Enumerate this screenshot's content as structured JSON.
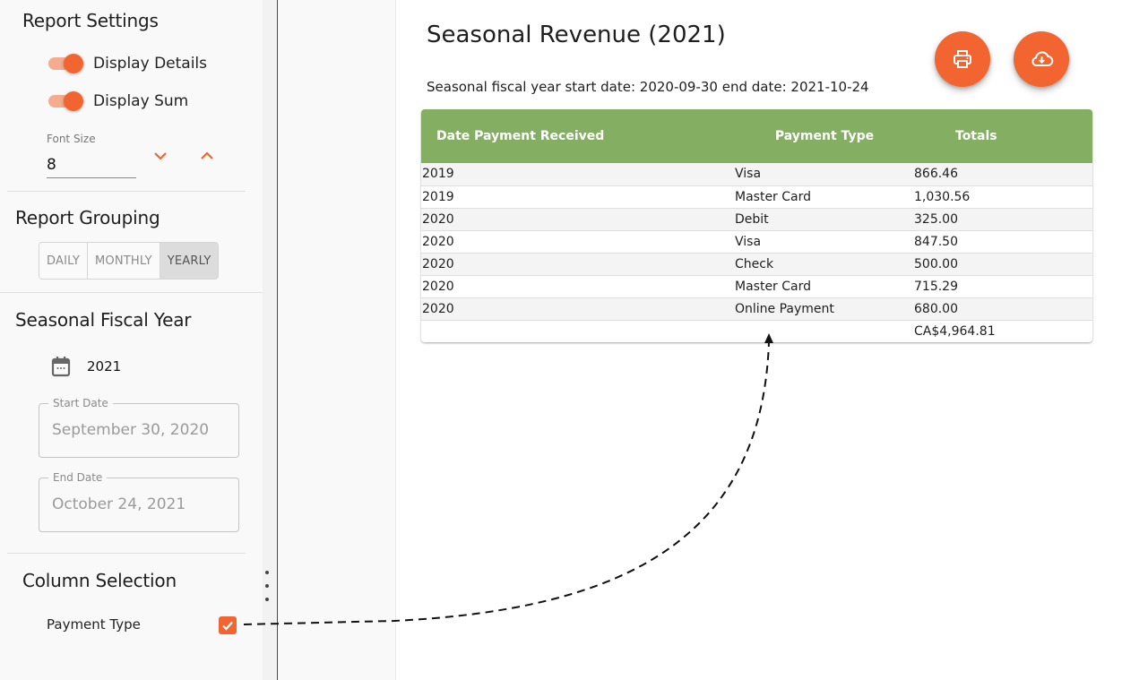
{
  "sidebar": {
    "report_settings": {
      "title": "Report Settings",
      "display_details": {
        "label": "Display Details",
        "checked": true
      },
      "display_sum": {
        "label": "Display Sum",
        "checked": true
      },
      "font_size": {
        "label": "Font Size",
        "value": "8"
      }
    },
    "report_grouping": {
      "title": "Report Grouping",
      "options": [
        "DAILY",
        "MONTHLY",
        "YEARLY"
      ],
      "selected": "YEARLY"
    },
    "seasonal_fiscal_year": {
      "title": "Seasonal Fiscal Year",
      "year": "2021",
      "start_date": {
        "label": "Start Date",
        "value": "September 30, 2020"
      },
      "end_date": {
        "label": "End Date",
        "value": "October 24, 2021"
      }
    },
    "column_selection": {
      "title": "Column Selection",
      "items": [
        {
          "label": "Payment Type",
          "checked": true
        }
      ]
    }
  },
  "report": {
    "title": "Seasonal Revenue (2021)",
    "subtitle": "Seasonal fiscal year start date: 2020-09-30 end date: 2021-10-24",
    "actions": {
      "print": "print-icon",
      "download": "cloud-download-icon"
    },
    "table": {
      "headers": [
        "Date Payment Received",
        "Payment Type",
        "Totals"
      ],
      "rows": [
        [
          "2019",
          "Visa",
          "866.46"
        ],
        [
          "2019",
          "Master Card",
          "1,030.56"
        ],
        [
          "2020",
          "Debit",
          "325.00"
        ],
        [
          "2020",
          "Visa",
          "847.50"
        ],
        [
          "2020",
          "Check",
          "500.00"
        ],
        [
          "2020",
          "Master Card",
          "715.29"
        ],
        [
          "2020",
          "Online Payment",
          "680.00"
        ]
      ],
      "total": "CA$4,964.81"
    }
  },
  "colors": {
    "accent": "#f26531",
    "header_green": "#84ae62"
  }
}
